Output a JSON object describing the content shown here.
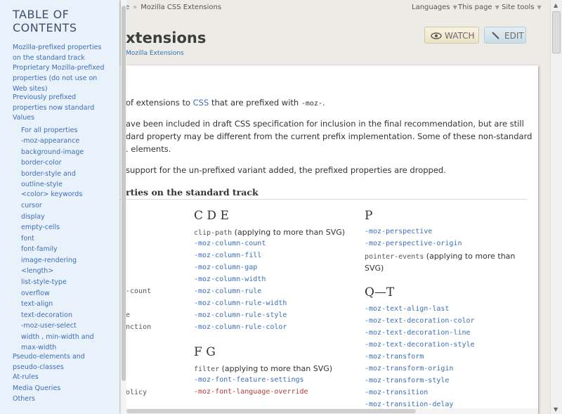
{
  "topbar": {
    "crumb_prefix": "e",
    "crumb_current": "Mozilla CSS Extensions",
    "languages": "Languages",
    "this_page": "This page",
    "site_tools": "Site tools"
  },
  "header": {
    "title": "xtensions",
    "subcrumb": "Mozilla Extensions",
    "watch_label": "WATCH",
    "edit_label": "EDIT",
    "watch_icon": "eye-icon",
    "edit_icon": "pencil-icon"
  },
  "intro": {
    "line1_pre": "of extensions to ",
    "line1_link": "CSS",
    "line1_mid": " that are prefixed with ",
    "line1_code": "-moz-",
    "line1_end": ".",
    "line2": "ave been included in draft CSS specification for inclusion in the final recommendation, but are still",
    "line3": "dard property may be different from the current prefix implementation. Some of these non-standard",
    "line4": ". elements.",
    "line5": " support for the un-prefixed variant added, the prefixed properties are dropped."
  },
  "section": {
    "heading": "rties on the standard track"
  },
  "left_col": {
    "items": [
      "-count",
      "e",
      "nction",
      "olicy"
    ]
  },
  "col_cde": {
    "heading": "C D E",
    "items": [
      {
        "name": "clip-path",
        "note": " (applying to more than SVG)"
      },
      {
        "name": "-moz-column-count",
        "note": ""
      },
      {
        "name": "-moz-column-fill",
        "note": ""
      },
      {
        "name": "-moz-column-gap",
        "note": ""
      },
      {
        "name": "-moz-column-width",
        "note": ""
      },
      {
        "name": "-moz-column-rule",
        "note": ""
      },
      {
        "name": "-moz-column-rule-width",
        "note": ""
      },
      {
        "name": "-moz-column-rule-style",
        "note": ""
      },
      {
        "name": "-moz-column-rule-color",
        "note": ""
      }
    ]
  },
  "col_fg": {
    "heading": "F G",
    "items": [
      {
        "name": "filter",
        "note": " (applying to more than SVG)"
      },
      {
        "name": "-moz-font-feature-settings",
        "note": ""
      },
      {
        "name": "-moz-font-language-override",
        "note": ""
      }
    ]
  },
  "col_p": {
    "heading": "P",
    "items": [
      {
        "name": "-moz-perspective",
        "note": ""
      },
      {
        "name": "-moz-perspective-origin",
        "note": ""
      },
      {
        "name": "pointer-events",
        "note": " (applying to more than SVG)"
      }
    ],
    "note_wrap": "SVG)"
  },
  "col_qt": {
    "heading": "Q—T",
    "items": [
      "-moz-text-align-last",
      "-moz-text-decoration-color",
      "-moz-text-decoration-line",
      "-moz-text-decoration-style",
      "-moz-transform",
      "-moz-transform-origin",
      "-moz-transform-style",
      "-moz-transition",
      "-moz-transition-delay"
    ]
  },
  "toc": {
    "title": "TABLE OF CONTENTS",
    "items": [
      "Mozilla-prefixed properties on the standard track",
      "Proprietary Mozilla-prefixed properties (do not use on Web sites)",
      "Previously prefixed properties now standard",
      "Values"
    ],
    "values_sub": [
      "For all properties",
      "-moz-appearance",
      "background-image",
      "border-color",
      "border-style and outline-style",
      "<color> keywords",
      "cursor",
      "display",
      "empty-cells",
      "font",
      "font-family",
      "image-rendering",
      "<length>",
      "list-style-type",
      "overflow",
      "text-align",
      "text-decoration",
      "-moz-user-select",
      "width , min-width and max-width"
    ],
    "tail": [
      "Pseudo-elements and pseudo-classes",
      "At-rules",
      "Media Queries",
      "Others"
    ]
  },
  "colors": {
    "link": "#3b6fb6",
    "obsolete": "#b23a3a",
    "toc_bg": "#e9f1fa"
  }
}
